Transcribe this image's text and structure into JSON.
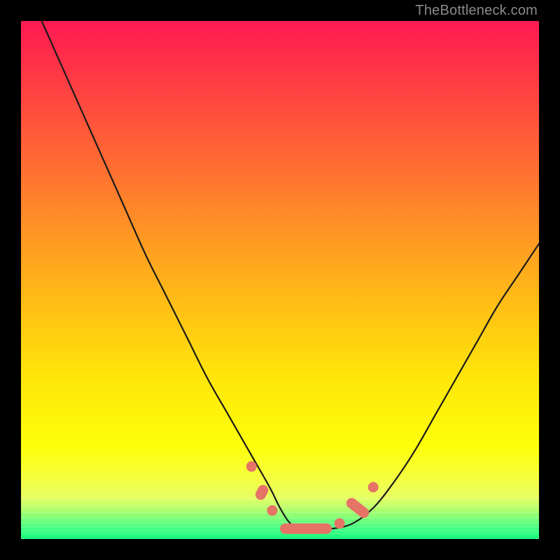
{
  "watermark": "TheBottleneck.com",
  "colors": {
    "page_bg": "#000000",
    "gradient_top": "#ff1a52",
    "gradient_mid1": "#ff9624",
    "gradient_mid2": "#fdff0a",
    "gradient_bottom": "#17f87e",
    "curve": "#1a1a1a",
    "beads": "#e57366",
    "watermark_text": "#8a8a8a"
  },
  "chart_data": {
    "type": "line",
    "title": "",
    "xlabel": "",
    "ylabel": "",
    "xlim": [
      0,
      100
    ],
    "ylim": [
      0,
      100
    ],
    "grid": false,
    "legend": false,
    "series": [
      {
        "name": "bottleneck-curve",
        "x": [
          4,
          8,
          12,
          16,
          20,
          24,
          28,
          32,
          36,
          40,
          44,
          48,
          50,
          52,
          54,
          56,
          60,
          64,
          68,
          72,
          76,
          80,
          84,
          88,
          92,
          96,
          100
        ],
        "y": [
          100,
          91,
          82,
          73,
          64,
          55,
          47,
          39,
          31,
          24,
          17,
          10,
          6,
          3,
          2,
          2,
          2,
          3,
          6,
          11,
          17,
          24,
          31,
          38,
          45,
          51,
          57
        ]
      }
    ],
    "markers": [
      {
        "kind": "dot",
        "x": 44.5,
        "y": 14
      },
      {
        "kind": "pill",
        "x": 46.5,
        "y": 9,
        "len": 3,
        "angle": -62
      },
      {
        "kind": "dot",
        "x": 48.5,
        "y": 5.5
      },
      {
        "kind": "pill",
        "x": 55,
        "y": 2,
        "len": 10,
        "angle": 0
      },
      {
        "kind": "dot",
        "x": 61.5,
        "y": 3
      },
      {
        "kind": "pill",
        "x": 65,
        "y": 6,
        "len": 5,
        "angle": 38
      },
      {
        "kind": "dot",
        "x": 68,
        "y": 10
      }
    ],
    "annotations": []
  }
}
